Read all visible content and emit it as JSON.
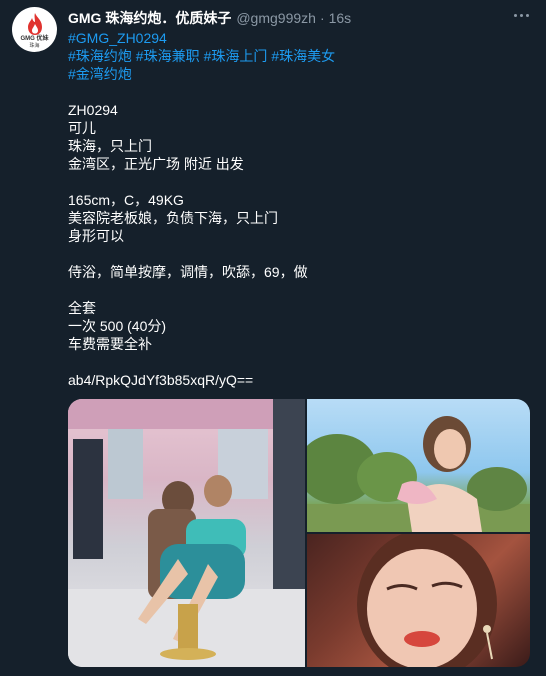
{
  "tweet": {
    "avatar": {
      "line1": "GMG 优妹",
      "line2": "珠海",
      "icon": "flame-icon",
      "accent": "#e0332f"
    },
    "display_name": "GMG 珠海约炮．优质妹子",
    "handle": "@gmg999zh",
    "separator": "·",
    "time": "16s",
    "hashtags_line1": [
      "#GMG_ZH0294"
    ],
    "hashtags_line2": [
      "#珠海约炮",
      "#珠海兼职",
      "#珠海上门",
      "#珠海美女"
    ],
    "hashtags_line3": [
      "#金湾约炮"
    ],
    "lines": [
      "ZH0294",
      "可儿",
      "珠海，只上门",
      "金湾区，正光广场 附近 出发",
      "",
      "165cm，C，49KG",
      "美容院老板娘，负债下海，只上门",
      "身形可以",
      "",
      "侍浴，简单按摩，调情，吹舔，69，做",
      "",
      "全套",
      "一次 500 (40分)",
      "车费需要全补",
      "",
      "ab4/RpkQJdYf3b85xqR/yQ=="
    ],
    "more_icon": "more-horizontal-icon",
    "media": [
      "photo-salon",
      "photo-outdoor",
      "photo-closeup"
    ]
  },
  "colors": {
    "background": "#15202b",
    "text": "#ffffff",
    "secondary": "#8b98a5",
    "link": "#1d9bf0"
  }
}
